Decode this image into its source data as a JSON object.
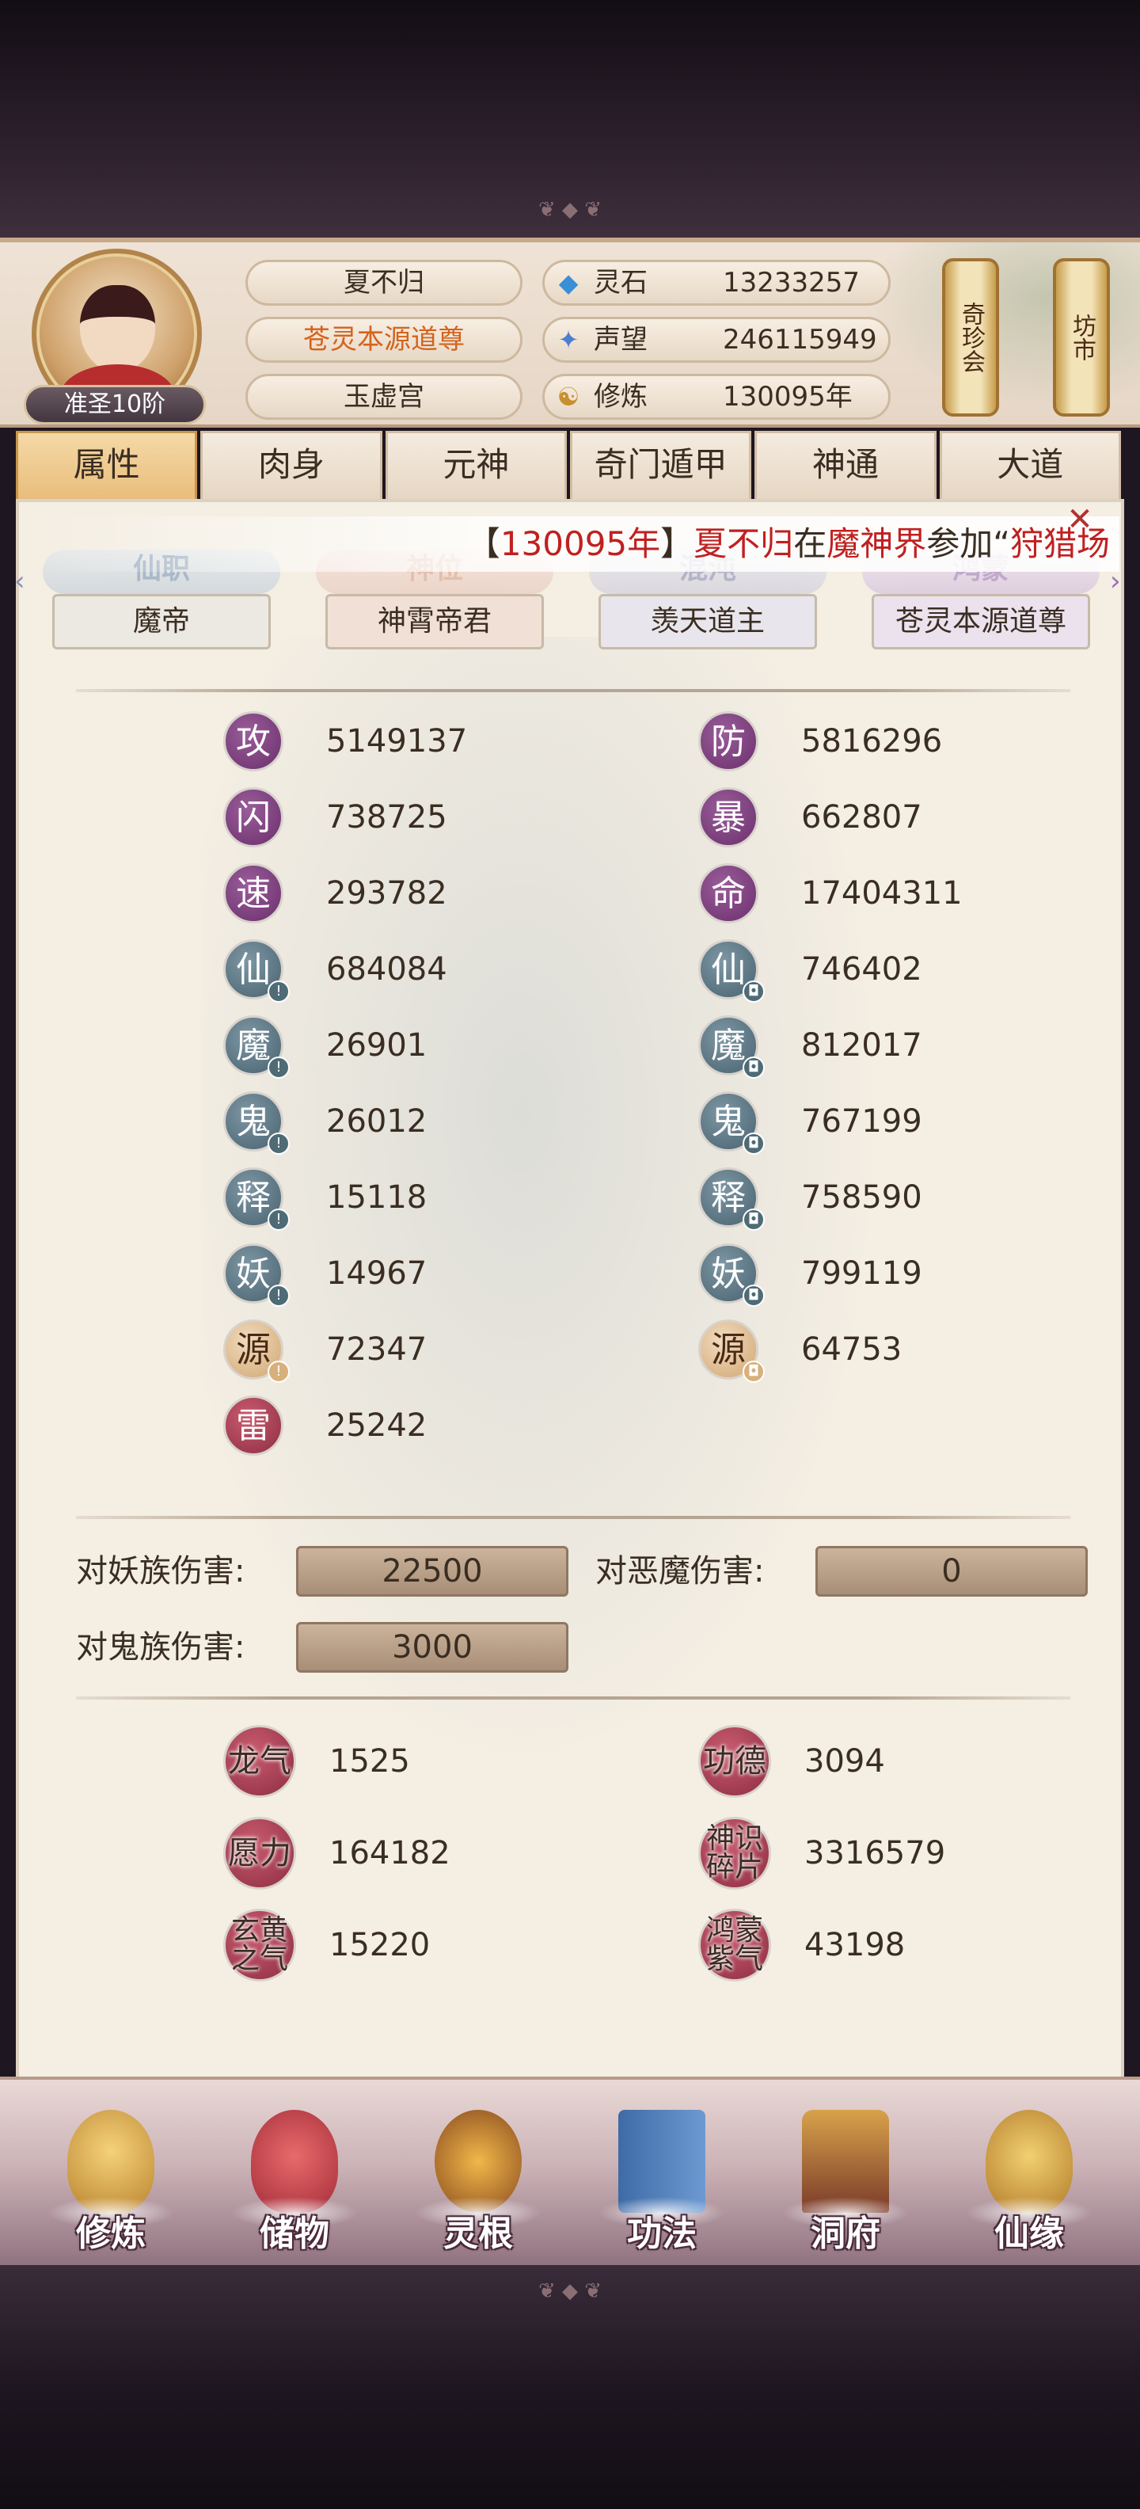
{
  "player": {
    "name": "夏不归",
    "title": "苍灵本源道尊",
    "sect": "玉虚宫",
    "rank": "准圣10阶"
  },
  "resources": [
    {
      "label": "灵石",
      "value": "13233257",
      "icon": "spirit-stone-icon"
    },
    {
      "label": "声望",
      "value": "246115949",
      "icon": "reputation-icon"
    },
    {
      "label": "修炼",
      "value": "130095年",
      "icon": "cultivation-icon"
    }
  ],
  "side_buttons": {
    "treasure": "奇珍会",
    "market": "坊市"
  },
  "tabs": [
    "属性",
    "肉身",
    "元神",
    "奇门遁甲",
    "神通",
    "大道"
  ],
  "broadcast": {
    "bracket_open": "【",
    "years": "130095年",
    "bracket_close": "】",
    "name": "夏不归",
    "mid": "在",
    "realm": "魔神界",
    "action": "参加“",
    "event": "狩猎场"
  },
  "titles": [
    {
      "label": "仙职",
      "value": "魔帝"
    },
    {
      "label": "神位",
      "value": "神霄帝君"
    },
    {
      "label": "混沌",
      "value": "羡天道主"
    },
    {
      "label": "鸿蒙",
      "value": "苍灵本源道尊"
    }
  ],
  "stats_left": [
    {
      "icon": "攻",
      "value": "5149137"
    },
    {
      "icon": "闪",
      "value": "738725"
    },
    {
      "icon": "速",
      "value": "293782"
    },
    {
      "icon": "仙",
      "value": "684084"
    },
    {
      "icon": "魔",
      "value": "26901"
    },
    {
      "icon": "鬼",
      "value": "26012"
    },
    {
      "icon": "释",
      "value": "15118"
    },
    {
      "icon": "妖",
      "value": "14967"
    },
    {
      "icon": "源",
      "value": "72347"
    },
    {
      "icon": "雷",
      "value": "25242"
    }
  ],
  "stats_right": [
    {
      "icon": "防",
      "value": "5816296"
    },
    {
      "icon": "暴",
      "value": "662807"
    },
    {
      "icon": "命",
      "value": "17404311"
    },
    {
      "icon": "仙",
      "value": "746402"
    },
    {
      "icon": "魔",
      "value": "812017"
    },
    {
      "icon": "鬼",
      "value": "767199"
    },
    {
      "icon": "释",
      "value": "758590"
    },
    {
      "icon": "妖",
      "value": "799119"
    },
    {
      "icon": "源",
      "value": "64753"
    }
  ],
  "damage": [
    {
      "label": "对妖族伤害:",
      "value": "22500"
    },
    {
      "label": "对恶魔伤害:",
      "value": "0"
    },
    {
      "label": "对鬼族伤害:",
      "value": "3000"
    }
  ],
  "extras": [
    {
      "name": "龙气",
      "value": "1525"
    },
    {
      "name": "功德",
      "value": "3094"
    },
    {
      "name": "愿力",
      "value": "164182"
    },
    {
      "name": "神识碎片",
      "value": "3316579"
    },
    {
      "name": "玄黄之气",
      "value": "15220"
    },
    {
      "name": "鸿蒙紫气",
      "value": "43198"
    }
  ],
  "bottom_nav": [
    "修炼",
    "储物",
    "灵根",
    "功法",
    "洞府",
    "仙缘"
  ],
  "colors": {
    "accent_red": "#c02020",
    "title_orange": "#d4631c",
    "panel_bg": "#f4eee3"
  }
}
